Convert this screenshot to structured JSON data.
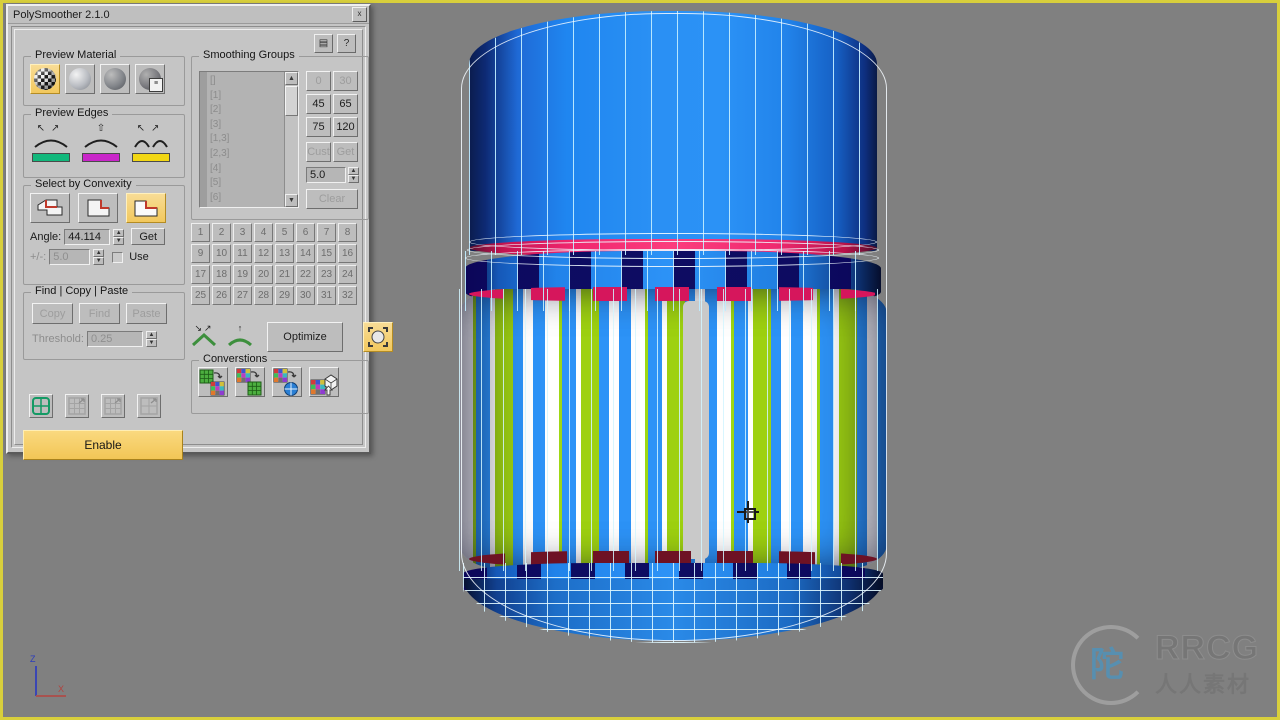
{
  "app": {
    "window_title": "PolySmoother 2.1.0",
    "close_label": "x",
    "toolbar": [
      {
        "name": "preset-icon",
        "glyph": "▤"
      },
      {
        "name": "help-icon",
        "glyph": "?"
      }
    ]
  },
  "preview_material": {
    "group_label": "Preview Material",
    "buttons": [
      {
        "name": "material-checker",
        "selected": true
      },
      {
        "name": "material-light-gray",
        "selected": false
      },
      {
        "name": "material-dark-gray",
        "selected": false
      },
      {
        "name": "material-custom-settings",
        "selected": false
      }
    ]
  },
  "preview_edges": {
    "group_label": "Preview Edges",
    "items": [
      {
        "name": "edge-convex",
        "arrows": "↖↗",
        "color": "#12b87c"
      },
      {
        "name": "edge-flat",
        "arrows": "⇧",
        "color": "#c926c9"
      },
      {
        "name": "edge-concave",
        "arrows": "↖↗",
        "color": "#f2d714"
      }
    ]
  },
  "select_by_convexity": {
    "group_label": "Select by Convexity",
    "buttons": [
      {
        "name": "convexity-convex",
        "selected": false
      },
      {
        "name": "convexity-concave",
        "selected": false
      },
      {
        "name": "convexity-both",
        "selected": true
      }
    ],
    "angle_label": "Angle:",
    "angle_value": "44.114",
    "get_label": "Get",
    "tolerance_label": "+/-:",
    "tolerance_value": "5.0",
    "use_label": "Use",
    "use_checked": false
  },
  "find_copy_paste": {
    "group_label": "Find | Copy | Paste",
    "copy_label": "Copy",
    "find_label": "Find",
    "paste_label": "Paste",
    "threshold_label": "Threshold:",
    "threshold_value": "0.25"
  },
  "mode_buttons": [
    {
      "name": "mode-faces",
      "selected": true
    },
    {
      "name": "mode-elements",
      "selected": false
    },
    {
      "name": "mode-objects",
      "selected": false
    },
    {
      "name": "mode-scene",
      "selected": false
    }
  ],
  "enable": {
    "label": "Enable"
  },
  "smoothing_groups": {
    "group_label": "Smoothing Groups",
    "list_items": [
      "[]",
      "[1]",
      "[2]",
      "[3]",
      "[1,3]",
      "[2,3]",
      "[4]",
      "[5]",
      "[6]"
    ],
    "angle_presets": [
      "0",
      "30",
      "45",
      "65",
      "75",
      "120"
    ],
    "cust_label": "Cust",
    "get_label": "Get",
    "value": "5.0",
    "clear_label": "Clear",
    "grid": [
      [
        "1",
        "2",
        "3",
        "4",
        "5",
        "6",
        "7",
        "8"
      ],
      [
        "9",
        "10",
        "11",
        "12",
        "13",
        "14",
        "15",
        "16"
      ],
      [
        "17",
        "18",
        "19",
        "20",
        "21",
        "22",
        "23",
        "24"
      ],
      [
        "25",
        "26",
        "27",
        "28",
        "29",
        "30",
        "31",
        "32"
      ]
    ]
  },
  "actions": {
    "spread_icon": "spread-smoothing-icon",
    "lift_icon": "lift-smoothing-icon",
    "optimize_label": "Optimize",
    "target_icon": "target-material-icon"
  },
  "conversions": {
    "group_label": "Converstions",
    "buttons": [
      {
        "name": "convert-smoothing-to-material"
      },
      {
        "name": "convert-material-to-smoothing"
      },
      {
        "name": "convert-material-to-map"
      },
      {
        "name": "convert-material-to-object"
      }
    ]
  },
  "viewport": {
    "axis": {
      "z_label": "Z",
      "x_label": "X"
    },
    "border_color": "#d8cf3c",
    "background_color": "#808080"
  },
  "watermark": {
    "brand": "RRCG",
    "subtitle": "人人素材",
    "shield_glyph": "陀"
  }
}
